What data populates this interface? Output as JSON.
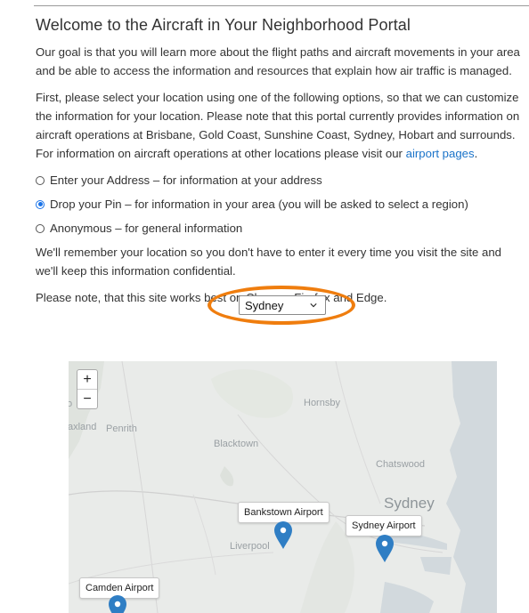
{
  "header": {
    "title": "Welcome to the Aircraft in Your Neighborhood Portal"
  },
  "intro": {
    "p1": "Our goal is that you will learn more about the flight paths and aircraft movements in your area and be able to access the information and resources that explain how air traffic is managed.",
    "p2_text": "First, please select your location using one of the following options, so that we can customize the information for your location. Please note that this portal currently provides information on aircraft operations at Brisbane, Gold Coast, Sunshine Coast, Sydney, Hobart and surrounds. For information on aircraft operations at other locations please visit our ",
    "p2_link": "airport pages",
    "p2_end": "."
  },
  "options": [
    {
      "label": "Enter your Address – for information at your address",
      "checked": false
    },
    {
      "label": "Drop your Pin – for information in your area (you will be asked to select a region)",
      "checked": true
    },
    {
      "label": "Anonymous – for general information",
      "checked": false
    }
  ],
  "remember": "We'll remember your location so you don't have to enter it every time you visit the site and we'll keep this information confidential.",
  "browser_note": "Please note, that this site works best on Chrome, Firefox and Edge.",
  "region_select": {
    "value": "Sydney"
  },
  "map": {
    "zoom_in": "+",
    "zoom_out": "−",
    "places": {
      "hornsby": "Hornsby",
      "penrith": "Penrith",
      "blacktown": "Blacktown",
      "chatswood": "Chatswood",
      "sydney": "Sydney",
      "liverpool": "Liverpool",
      "axland": "axland",
      "edge_o": "o"
    },
    "airports": [
      {
        "label": "Bankstown Airport"
      },
      {
        "label": "Sydney Airport"
      },
      {
        "label": "Camden Airport"
      }
    ],
    "pin_color": "#2f7ec4",
    "accent": "#ef7d0e"
  }
}
